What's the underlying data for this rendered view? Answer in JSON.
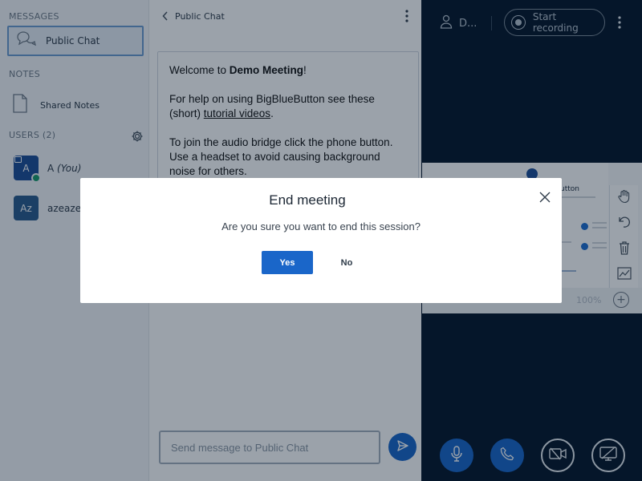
{
  "sidebar": {
    "messages_title": "MESSAGES",
    "public_chat_label": "Public Chat",
    "notes_title": "NOTES",
    "shared_notes_label": "Shared Notes",
    "users_title": "USERS (2)",
    "users": [
      {
        "initials": "A",
        "name": "A",
        "suffix": "(You)"
      },
      {
        "initials": "Az",
        "name": "azeaze",
        "suffix": ""
      }
    ]
  },
  "chat": {
    "title": "Public Chat",
    "welcome_prefix": "Welcome to ",
    "meeting_name": "Demo Meeting",
    "welcome_suffix": "!",
    "help_text": "For help on using BigBlueButton see these (short) ",
    "tutorial_link": "tutorial videos",
    "help_end": ".",
    "audio_text": "To join the audio bridge click the phone button. Use a headset to avoid causing background noise for others.",
    "input_placeholder": "Send message to Public Chat"
  },
  "topbar": {
    "user_label": "D...",
    "record_label": "Start recording"
  },
  "presentation": {
    "slide_title": "utton",
    "zoom": "100%"
  },
  "modal": {
    "title": "End meeting",
    "message": "Are you sure you want to end this session?",
    "yes_label": "Yes",
    "no_label": "No"
  },
  "colors": {
    "primary": "#1a66c9",
    "dark_bg": "#06172a",
    "online": "#1a9a6c"
  },
  "icons": [
    "chat-icon",
    "notes-icon",
    "gear-icon",
    "chevron-left-icon",
    "more-vertical-icon",
    "user-icon",
    "record-icon",
    "hand-icon",
    "undo-icon",
    "trash-icon",
    "chart-icon",
    "plus-icon",
    "send-icon",
    "microphone-icon",
    "phone-icon",
    "video-off-icon",
    "screenshare-off-icon",
    "close-icon"
  ]
}
